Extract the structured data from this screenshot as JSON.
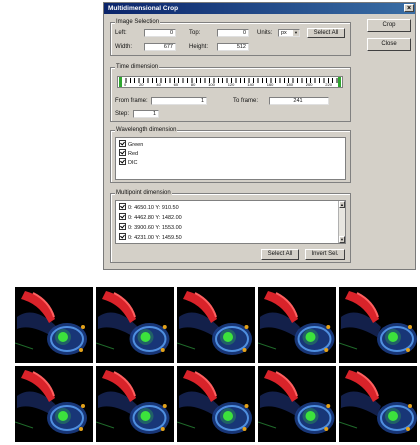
{
  "dialog": {
    "title": "Multidimensional Crop",
    "close_glyph": "×",
    "buttons": {
      "crop": "Crop",
      "close": "Close"
    },
    "image_selection": {
      "legend": "Image Selection",
      "left_label": "Left:",
      "left_value": "0",
      "top_label": "Top:",
      "top_value": "0",
      "units_label": "Units:",
      "units_value": "px",
      "select_all": "Select All",
      "width_label": "Width:",
      "width_value": "677",
      "height_label": "Height:",
      "height_value": "512"
    },
    "time_dimension": {
      "legend": "Time dimension",
      "scale": [
        "0",
        "20",
        "40",
        "60",
        "80",
        "100",
        "120",
        "140",
        "160",
        "180",
        "200",
        "220"
      ],
      "from_label": "From frame:",
      "from_value": "1",
      "to_label": "To frame:",
      "to_value": "241",
      "step_label": "Step:",
      "step_value": "1"
    },
    "wavelength_dimension": {
      "legend": "Wavelength dimension",
      "items": [
        "Green",
        "Red",
        "DIC"
      ]
    },
    "multipoint_dimension": {
      "legend": "Multipoint dimension",
      "items": [
        "0: 4650.10 Y: 910.50",
        "0: 4462.80 Y: 1482.00",
        "0: 3900.60 Y: 1553.00",
        "0: 4231.00 Y: 1459.50"
      ],
      "select_all": "Select All",
      "invert_sel": "Invert Sel."
    }
  },
  "thumbnails": {
    "rows": 2,
    "columns": 5
  }
}
